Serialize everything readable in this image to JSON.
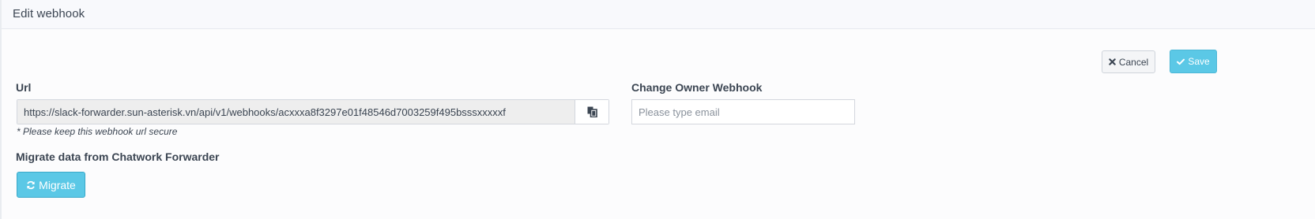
{
  "header": {
    "title": "Edit webhook"
  },
  "actions": {
    "cancel_label": "Cancel",
    "save_label": "Save"
  },
  "url_field": {
    "label": "Url",
    "value": "https://slack-forwarder.sun-asterisk.vn/api/v1/webhooks/acxxxa8f3297e01f48546d7003259f495bsssxxxxxf",
    "hint": "* Please keep this webhook url secure",
    "copy_icon": "copy-icon"
  },
  "owner_field": {
    "label": "Change Owner Webhook",
    "placeholder": "Please type email"
  },
  "migrate": {
    "label": "Migrate data from Chatwork Forwarder",
    "button_label": "Migrate",
    "button_icon": "refresh-icon"
  },
  "colors": {
    "accent": "#5bc8e6",
    "text": "#3b4552",
    "header_bg": "#f8f9fc"
  }
}
